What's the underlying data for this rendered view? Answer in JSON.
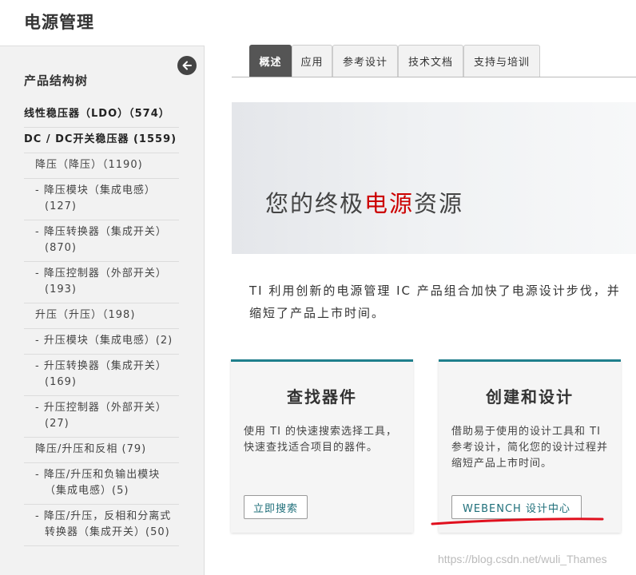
{
  "page": {
    "title": "电源管理"
  },
  "sidebar": {
    "title": "产品结构树",
    "items": [
      {
        "label": "线性稳压器（LDO）（574）"
      },
      {
        "label": "DC / DC开关稳压器 (1559)"
      },
      {
        "label": "降压（降压）（1190)"
      },
      {
        "label": "- 降压模块（集成电感）(127)"
      },
      {
        "label": "- 降压转换器（集成开关）(870)"
      },
      {
        "label": "- 降压控制器（外部开关）(193)"
      },
      {
        "label": "升压（升压）（198)"
      },
      {
        "label": "- 升压模块（集成电感）(2)"
      },
      {
        "label": "- 升压转换器（集成开关）(169)"
      },
      {
        "label": "- 升压控制器（外部开关）(27)"
      },
      {
        "label": "降压/升压和反相 (79)"
      },
      {
        "label": "- 降压/升压和负输出模块（集成电感）(5)"
      },
      {
        "label": "- 降压/升压，反相和分离式转换器（集成开关）(50)"
      }
    ]
  },
  "tabs": [
    {
      "label": "概述"
    },
    {
      "label": "应用"
    },
    {
      "label": "参考设计"
    },
    {
      "label": "技术文档"
    },
    {
      "label": "支持与培训"
    }
  ],
  "hero": {
    "prefix": "您的终极",
    "highlight": "电源",
    "suffix": "资源"
  },
  "intro": {
    "line1": "TI 利用创新的电源管理 IC 产品组合加快了电源设计步伐，并",
    "line2": "缩短了产品上市时间。"
  },
  "cards": [
    {
      "title": "查找器件",
      "desc": "使用 TI 的快速搜索选择工具，快速查找适合项目的器件。",
      "button": "立即搜索"
    },
    {
      "title": "创建和设计",
      "desc": "借助易于使用的设计工具和 TI 参考设计，简化您的设计过程并缩短产品上市时间。",
      "button": "WEBENCH 设计中心"
    }
  ],
  "watermark": "https://blog.csdn.net/wuli_Thames",
  "colors": {
    "accent": "#1f7f8c",
    "highlight": "#cc0000",
    "annotation": "#e0101e"
  }
}
